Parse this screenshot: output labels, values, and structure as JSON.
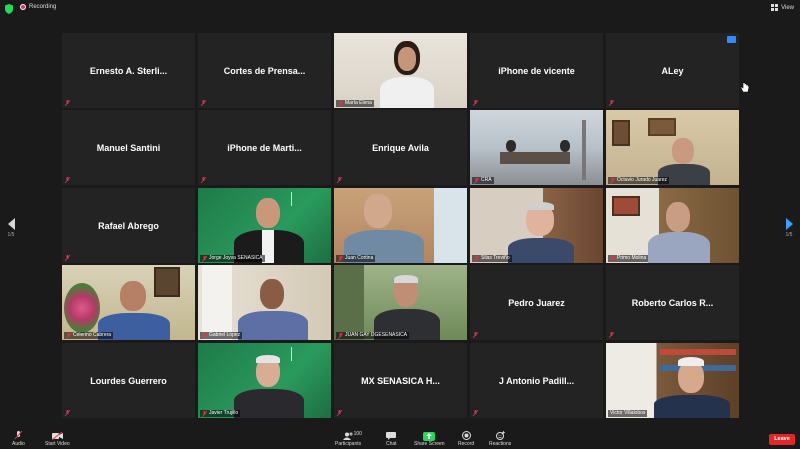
{
  "recording": {
    "label": "Recording"
  },
  "view": {
    "label": "View"
  },
  "pager": {
    "left": "1/5",
    "right": "1/5"
  },
  "tiles": [
    {
      "name": "Ernesto A. Sterli...",
      "video": false
    },
    {
      "name": "Cortes de Prensa...",
      "video": false
    },
    {
      "name": "María Elena",
      "video": true
    },
    {
      "name": "iPhone de vicente",
      "video": false
    },
    {
      "name": "ALey",
      "video": false
    },
    {
      "name": "Manuel Santini",
      "video": false
    },
    {
      "name": "iPhone de Marti...",
      "video": false
    },
    {
      "name": "Enrique Avila",
      "video": false
    },
    {
      "name": "CRA",
      "video": true
    },
    {
      "name": "Octavio Jurado Juarez",
      "video": true
    },
    {
      "name": "Rafael Abrego",
      "video": false
    },
    {
      "name": "Jorge Joyva SENASICA",
      "video": true
    },
    {
      "name": "Juan Cortina",
      "video": true
    },
    {
      "name": "Silas Treviño",
      "video": true
    },
    {
      "name": "Primo Molina",
      "video": true
    },
    {
      "name": "Celerino Cabrera",
      "video": true
    },
    {
      "name": "Gabriel Lopez",
      "video": true
    },
    {
      "name": "JUAN GAY DGESENASICA",
      "video": true
    },
    {
      "name": "Pedro Juarez",
      "video": false
    },
    {
      "name": "Roberto Carlos R...",
      "video": false
    },
    {
      "name": "Lourdes Guerrero",
      "video": false
    },
    {
      "name": "Javier Trujillo",
      "video": true
    },
    {
      "name": "MX SENASICA H...",
      "video": false
    },
    {
      "name": "J Antonio Padill...",
      "video": false
    },
    {
      "name": "Victor Villalobos",
      "video": true
    }
  ],
  "toolbar": {
    "audio": "Audio",
    "start_video": "Start Video",
    "participants": "Participants",
    "participants_count": "100",
    "chat": "Chat",
    "share_screen": "Share Screen",
    "record": "Record",
    "reactions": "Reactions",
    "leave": "Leave"
  },
  "colors": {
    "accent": "#2d8cff",
    "share": "#23d959",
    "leave": "#e02828",
    "active_speaker": "#d7e85a"
  }
}
